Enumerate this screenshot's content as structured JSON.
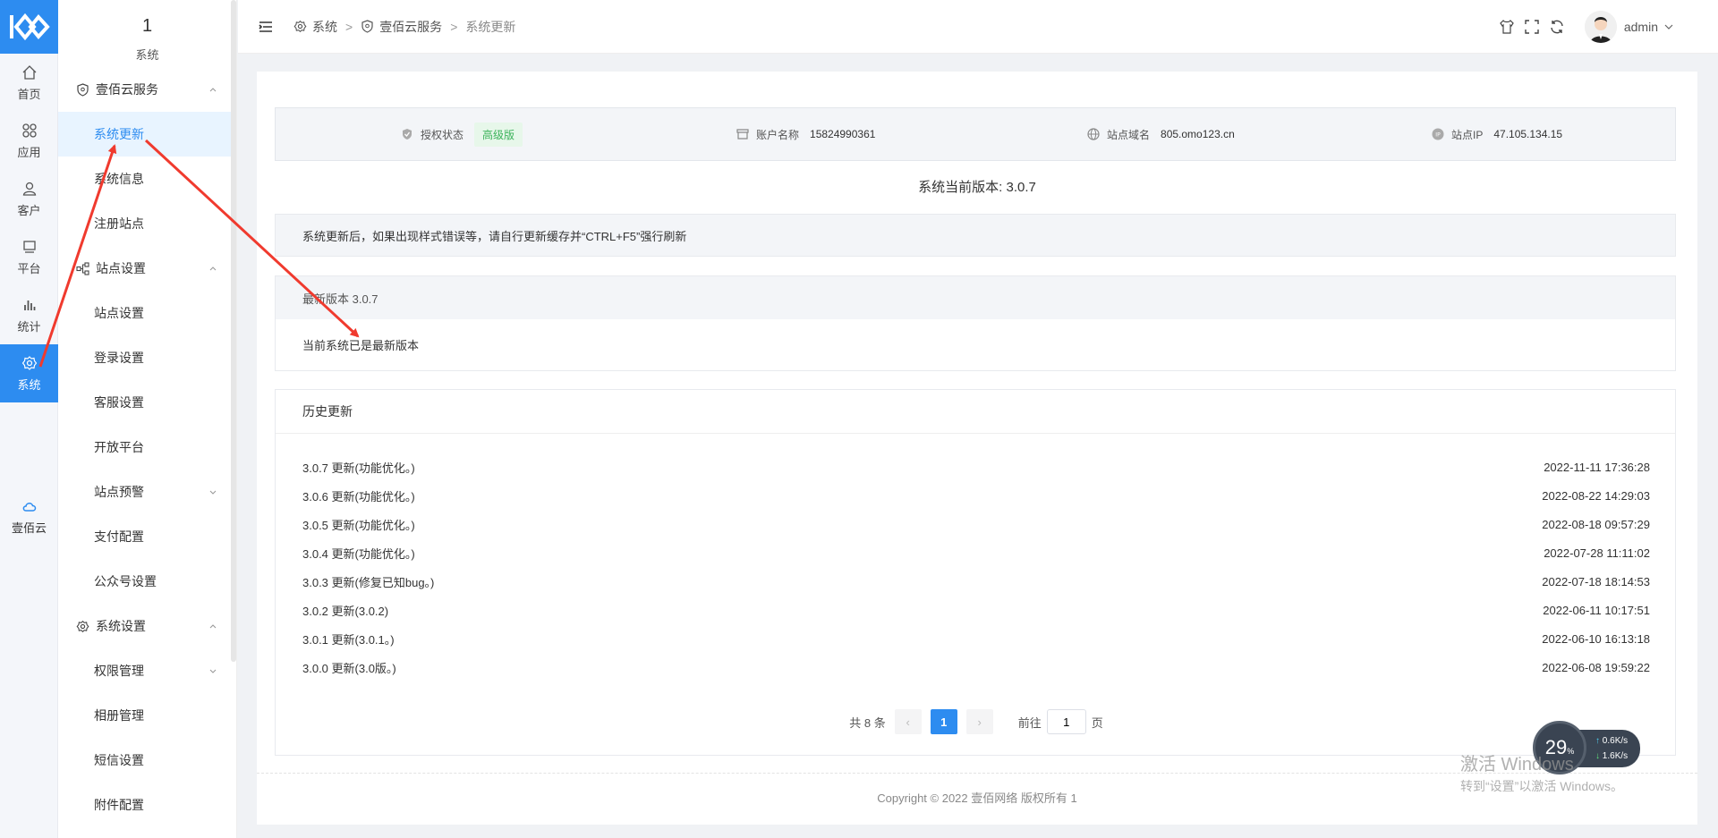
{
  "rail": {
    "items": [
      {
        "label": "首页",
        "icon": "home-icon"
      },
      {
        "label": "应用",
        "icon": "apps-icon"
      },
      {
        "label": "客户",
        "icon": "user-icon"
      },
      {
        "label": "平台",
        "icon": "platform-icon"
      },
      {
        "label": "统计",
        "icon": "stats-icon"
      },
      {
        "label": "系统",
        "icon": "gear-icon",
        "active": true
      }
    ],
    "cloud": {
      "label": "壹佰云",
      "icon": "cloud-icon"
    }
  },
  "menu": {
    "head_num": "1",
    "head_sub": "系统",
    "group1": "壹佰云服务",
    "item_system_update": "系统更新",
    "item_system_info": "系统信息",
    "item_register_site": "注册站点",
    "group2": "站点设置",
    "item_site_settings": "站点设置",
    "item_login_settings": "登录设置",
    "item_service_settings": "客服设置",
    "item_open_platform": "开放平台",
    "item_site_warning": "站点预警",
    "item_payment": "支付配置",
    "item_official_account": "公众号设置",
    "group3": "系统设置",
    "item_permission": "权限管理",
    "item_album": "相册管理",
    "item_sms": "短信设置",
    "item_attachment": "附件配置"
  },
  "breadcrumb": {
    "root": "系统",
    "sep": ">",
    "mid": "壹佰云服务",
    "current": "系统更新"
  },
  "header": {
    "username": "admin"
  },
  "info": {
    "auth_label": "授权状态",
    "auth_badge": "高级版",
    "account_label": "账户名称",
    "account_value": "15824990361",
    "domain_label": "站点域名",
    "domain_value": "805.omo123.cn",
    "ip_label": "站点IP",
    "ip_value": "47.105.134.15"
  },
  "current_version_text": "系统当前版本: 3.0.7",
  "notice_text": "系统更新后，如果出现样式错误等，请自行更新缓存并“CTRL+F5”强行刷新",
  "latest": {
    "header": "最新版本 3.0.7",
    "body": "当前系统已是最新版本"
  },
  "history": {
    "title": "历史更新",
    "rows": [
      {
        "desc": "3.0.7 更新(功能优化。)",
        "time": "2022-11-11 17:36:28"
      },
      {
        "desc": "3.0.6 更新(功能优化。)",
        "time": "2022-08-22 14:29:03"
      },
      {
        "desc": "3.0.5 更新(功能优化。)",
        "time": "2022-08-18 09:57:29"
      },
      {
        "desc": "3.0.4 更新(功能优化。)",
        "time": "2022-07-28 11:11:02"
      },
      {
        "desc": "3.0.3 更新(修复已知bug。)",
        "time": "2022-07-18 18:14:53"
      },
      {
        "desc": "3.0.2 更新(3.0.2)",
        "time": "2022-06-11 10:17:51"
      },
      {
        "desc": "3.0.1 更新(3.0.1。)",
        "time": "2022-06-10 16:13:18"
      },
      {
        "desc": "3.0.0 更新(3.0版。)",
        "time": "2022-06-08 19:59:22"
      }
    ]
  },
  "pager": {
    "total": "共 8 条",
    "prev": "‹",
    "current": "1",
    "next": "›",
    "goto_label": "前往",
    "goto_value": "1",
    "page_suffix": "页"
  },
  "footer": "Copyright © 2022 壹佰网络 版权所有   1",
  "widget": {
    "percent": "29",
    "percent_unit": "%",
    "up_speed": "0.6",
    "down_speed": "1.6",
    "unit": "K/s"
  },
  "watermark": {
    "line1": "激活 Windows",
    "line2": "转到“设置”以激活 Windows。"
  },
  "colors": {
    "accent": "#2d8cf0",
    "annotation": "#f03a2e",
    "badge_green": "#3cb35b"
  }
}
